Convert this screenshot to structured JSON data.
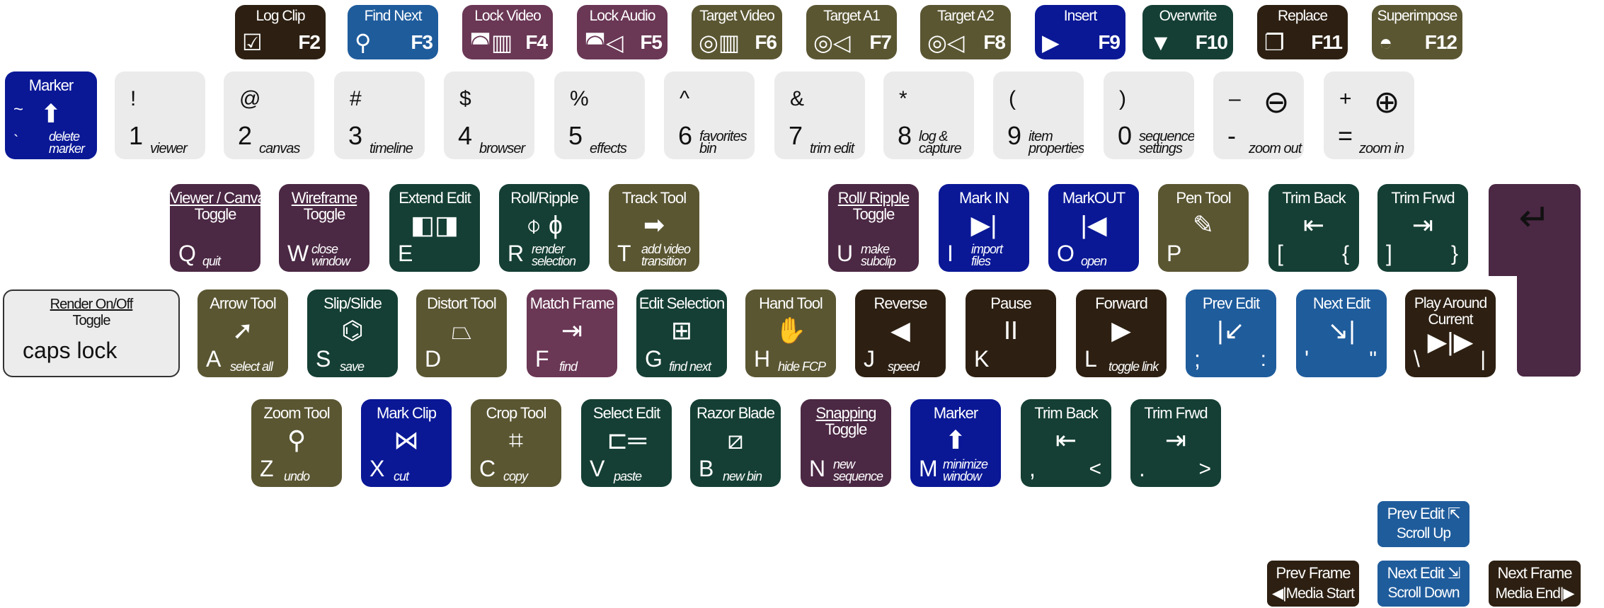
{
  "colors": {
    "brown": "#2d2012",
    "blue": "#1f5c9c",
    "plum": "#6a3755",
    "purple": "#4b2844",
    "olive": "#5a5632",
    "navy": "#0a1896",
    "green": "#153f34",
    "gray": "#ebebeb"
  },
  "function_row": [
    {
      "title": "Log Clip",
      "fkey": "F2",
      "icon": "log-clip-icon",
      "color": "brown"
    },
    {
      "title": "Find Next",
      "fkey": "F3",
      "icon": "find-next-icon",
      "color": "blue"
    },
    {
      "title": "Lock Video",
      "fkey": "F4",
      "icon": "lock-video-icon",
      "color": "plum"
    },
    {
      "title": "Lock Audio",
      "fkey": "F5",
      "icon": "lock-audio-icon",
      "color": "plum"
    },
    {
      "title": "Target Video",
      "fkey": "F6",
      "icon": "target-video-icon",
      "color": "olive"
    },
    {
      "title": "Target A1",
      "fkey": "F7",
      "icon": "target-a1-icon",
      "color": "olive"
    },
    {
      "title": "Target A2",
      "fkey": "F8",
      "icon": "target-a2-icon",
      "color": "olive"
    },
    {
      "title": "Insert",
      "fkey": "F9",
      "icon": "insert-icon",
      "color": "navy"
    },
    {
      "title": "Overwrite",
      "fkey": "F10",
      "icon": "overwrite-icon",
      "color": "green"
    },
    {
      "title": "Replace",
      "fkey": "F11",
      "icon": "replace-icon",
      "color": "brown"
    },
    {
      "title": "Superimpose",
      "fkey": "F12",
      "icon": "superimpose-icon",
      "color": "olive"
    }
  ],
  "marker_key": {
    "title": "Marker",
    "sym": "~",
    "num": "`",
    "sub": "delete marker",
    "icon": "marker-icon",
    "color": "navy"
  },
  "number_row": [
    {
      "sym": "!",
      "num": "1",
      "sub": "viewer"
    },
    {
      "sym": "@",
      "num": "2",
      "sub": "canvas"
    },
    {
      "sym": "#",
      "num": "3",
      "sub": "timeline"
    },
    {
      "sym": "$",
      "num": "4",
      "sub": "browser"
    },
    {
      "sym": "%",
      "num": "5",
      "sub": "effects"
    },
    {
      "sym": "^",
      "num": "6",
      "sub": "favorites bin"
    },
    {
      "sym": "&",
      "num": "7",
      "sub": "trim edit"
    },
    {
      "sym": "*",
      "num": "8",
      "sub": "log & capture"
    },
    {
      "sym": "(",
      "num": "9",
      "sub": "item properties"
    },
    {
      "sym": ")",
      "num": "0",
      "sub": "sequence settings"
    },
    {
      "sym": "–",
      "num": "-",
      "sub": "zoom out",
      "icon": "zoom-out-icon"
    },
    {
      "sym": "+",
      "num": "=",
      "sub": "zoom in",
      "icon": "zoom-in-icon"
    }
  ],
  "q_row": [
    {
      "title": "Viewer / Canvas",
      "title2": "Toggle",
      "letter": "Q",
      "sub": "quit",
      "color": "purple"
    },
    {
      "title": "Wireframe",
      "title2": "Toggle",
      "letter": "W",
      "sub": "close window",
      "color": "purple"
    },
    {
      "title": "Extend Edit",
      "letter": "E",
      "icon": "extend-edit-icon",
      "color": "green"
    },
    {
      "title": "Roll/Ripple",
      "letter": "R",
      "sub": "render selection",
      "icon": "roll-ripple-icon",
      "color": "green"
    },
    {
      "title": "Track Tool",
      "letter": "T",
      "sub": "add video transition",
      "icon": "track-tool-icon",
      "color": "olive"
    },
    {
      "title": "Roll/ Ripple",
      "title2": "Toggle",
      "letter": "U",
      "sub": "make subclip",
      "color": "purple"
    },
    {
      "title": "Mark IN",
      "letter": "I",
      "sub": "import files",
      "icon": "mark-in-icon",
      "color": "navy"
    },
    {
      "title": "MarkOUT",
      "letter": "O",
      "sub": "open",
      "icon": "mark-out-icon",
      "color": "navy"
    },
    {
      "title": "Pen Tool",
      "letter": "P",
      "icon": "pen-tool-icon",
      "color": "olive"
    },
    {
      "title": "Trim Back",
      "letter": "[",
      "alt": "{",
      "icon": "trim-back-icon",
      "color": "green"
    },
    {
      "title": "Trim Frwd",
      "letter": "]",
      "alt": "}",
      "icon": "trim-forward-icon",
      "color": "green"
    }
  ],
  "enter_key": {
    "icon": "return-icon",
    "color": "purple"
  },
  "caps_key": {
    "title": "Render On/Off",
    "title2": "Toggle",
    "letter": "caps lock"
  },
  "a_row": [
    {
      "title": "Arrow Tool",
      "letter": "A",
      "sub": "select all",
      "icon": "arrow-tool-icon",
      "color": "olive"
    },
    {
      "title": "Slip/Slide",
      "letter": "S",
      "sub": "save",
      "icon": "slip-slide-icon",
      "color": "green"
    },
    {
      "title": "Distort Tool",
      "letter": "D",
      "icon": "distort-tool-icon",
      "color": "olive"
    },
    {
      "title": "Match Frame",
      "letter": "F",
      "sub": "find",
      "icon": "match-frame-icon",
      "color": "plum"
    },
    {
      "title": "Edit Selection",
      "letter": "G",
      "sub": "find next",
      "icon": "edit-selection-icon",
      "color": "green"
    },
    {
      "title": "Hand Tool",
      "letter": "H",
      "sub": "hide FCP",
      "icon": "hand-tool-icon",
      "color": "olive"
    },
    {
      "title": "Reverse",
      "letter": "J",
      "sub": "speed",
      "icon": "reverse-icon",
      "color": "brown"
    },
    {
      "title": "Pause",
      "letter": "K",
      "icon": "pause-icon",
      "color": "brown"
    },
    {
      "title": "Forward",
      "letter": "L",
      "sub": "toggle link",
      "icon": "forward-icon",
      "color": "brown"
    },
    {
      "title": "Prev Edit",
      "letter": ";",
      "alt": ":",
      "icon": "prev-edit-icon",
      "color": "blue"
    },
    {
      "title": "Next Edit",
      "letter": "'",
      "alt": "\"",
      "icon": "next-edit-icon",
      "color": "blue"
    },
    {
      "title": "Play Around Current",
      "letter": "\\",
      "alt": "|",
      "icon": "play-around-icon",
      "color": "brown"
    }
  ],
  "z_row": [
    {
      "title": "Zoom Tool",
      "letter": "Z",
      "sub": "undo",
      "icon": "zoom-tool-icon",
      "color": "olive"
    },
    {
      "title": "Mark Clip",
      "letter": "X",
      "sub": "cut",
      "icon": "mark-clip-icon",
      "color": "navy"
    },
    {
      "title": "Crop Tool",
      "letter": "C",
      "sub": "copy",
      "icon": "crop-tool-icon",
      "color": "olive"
    },
    {
      "title": "Select Edit",
      "letter": "V",
      "sub": "paste",
      "icon": "select-edit-icon",
      "color": "green"
    },
    {
      "title": "Razor Blade",
      "letter": "B",
      "sub": "new bin",
      "icon": "razor-blade-icon",
      "color": "green"
    },
    {
      "title": "Snapping",
      "title2": "Toggle",
      "letter": "N",
      "sub": "new sequence",
      "color": "purple"
    },
    {
      "title": "Marker",
      "letter": "M",
      "sub": "minimize window",
      "icon": "marker-icon",
      "color": "navy"
    },
    {
      "title": "Trim Back",
      "letter": ",",
      "alt": "<",
      "icon": "trim-back-icon",
      "color": "green"
    },
    {
      "title": "Trim Frwd",
      "letter": ".",
      "alt": ">",
      "icon": "trim-forward-icon",
      "color": "green"
    }
  ],
  "nav_keys": [
    {
      "line1": "Prev Edit ⇱",
      "line2": "Scroll Up",
      "color": "blue"
    },
    {
      "line1": "Prev Frame",
      "line2": "◀|Media Start",
      "color": "brown"
    },
    {
      "line1": "Next Edit ⇲",
      "line2": "Scroll Down",
      "color": "blue"
    },
    {
      "line1": "Next Frame",
      "line2": "Media End|▶",
      "color": "brown"
    }
  ]
}
